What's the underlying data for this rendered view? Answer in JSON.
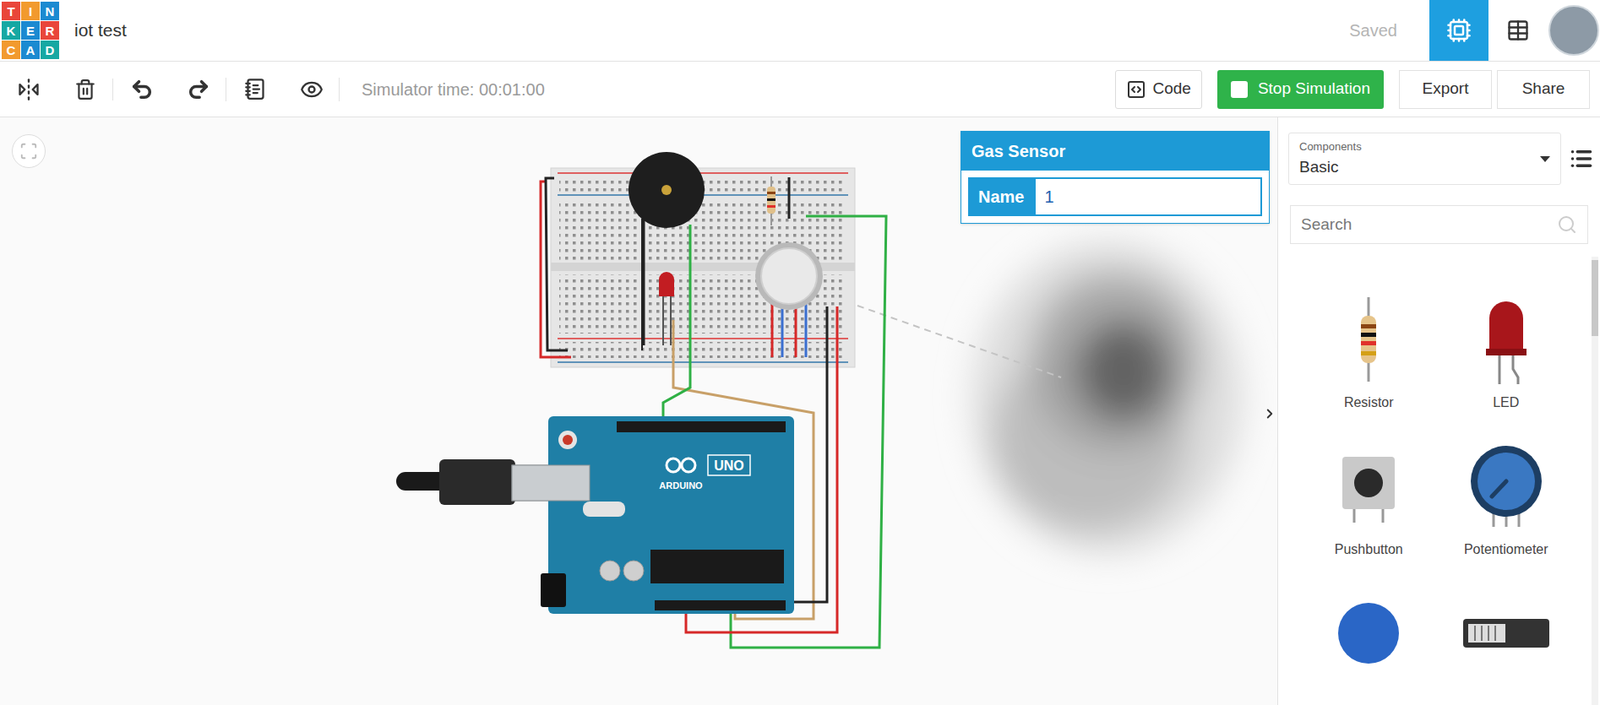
{
  "app": {
    "logo": [
      {
        "letter": "T",
        "color": "#e9463a"
      },
      {
        "letter": "I",
        "color": "#f29a2e"
      },
      {
        "letter": "N",
        "color": "#1b8ad1"
      },
      {
        "letter": "K",
        "color": "#16a8a3"
      },
      {
        "letter": "E",
        "color": "#1b8ad1"
      },
      {
        "letter": "R",
        "color": "#e9463a"
      },
      {
        "letter": "C",
        "color": "#f29a2e"
      },
      {
        "letter": "A",
        "color": "#1b8ad1"
      },
      {
        "letter": "D",
        "color": "#16a8a3"
      }
    ],
    "title": "iot test",
    "save_status": "Saved",
    "views": [
      {
        "kind": "circuit",
        "selected": true
      },
      {
        "kind": "list",
        "selected": false
      }
    ]
  },
  "toolbar": {
    "simulator_time": "Simulator time: 00:01:00",
    "code_button": "Code",
    "simulation": {
      "label": "Stop Simulation",
      "running": true
    },
    "buttons": [
      "Export",
      "Share"
    ]
  },
  "inspector": {
    "title": "Gas Sensor",
    "fields": [
      {
        "label": "Name",
        "value": "1"
      }
    ]
  },
  "components_panel": {
    "caption": "Components",
    "category": "Basic",
    "search_placeholder": "Search",
    "items": [
      {
        "label": "Resistor",
        "kind": "resistor"
      },
      {
        "label": "LED",
        "kind": "led"
      },
      {
        "label": "Pushbutton",
        "kind": "pushbutton"
      },
      {
        "label": "Potentiometer",
        "kind": "potentiometer"
      },
      {
        "kind": "capacitor"
      },
      {
        "kind": "slideswitch"
      }
    ]
  },
  "circuit": {
    "board": {
      "brand": "ARDUINO",
      "model": "UNO"
    },
    "smoke": true
  }
}
